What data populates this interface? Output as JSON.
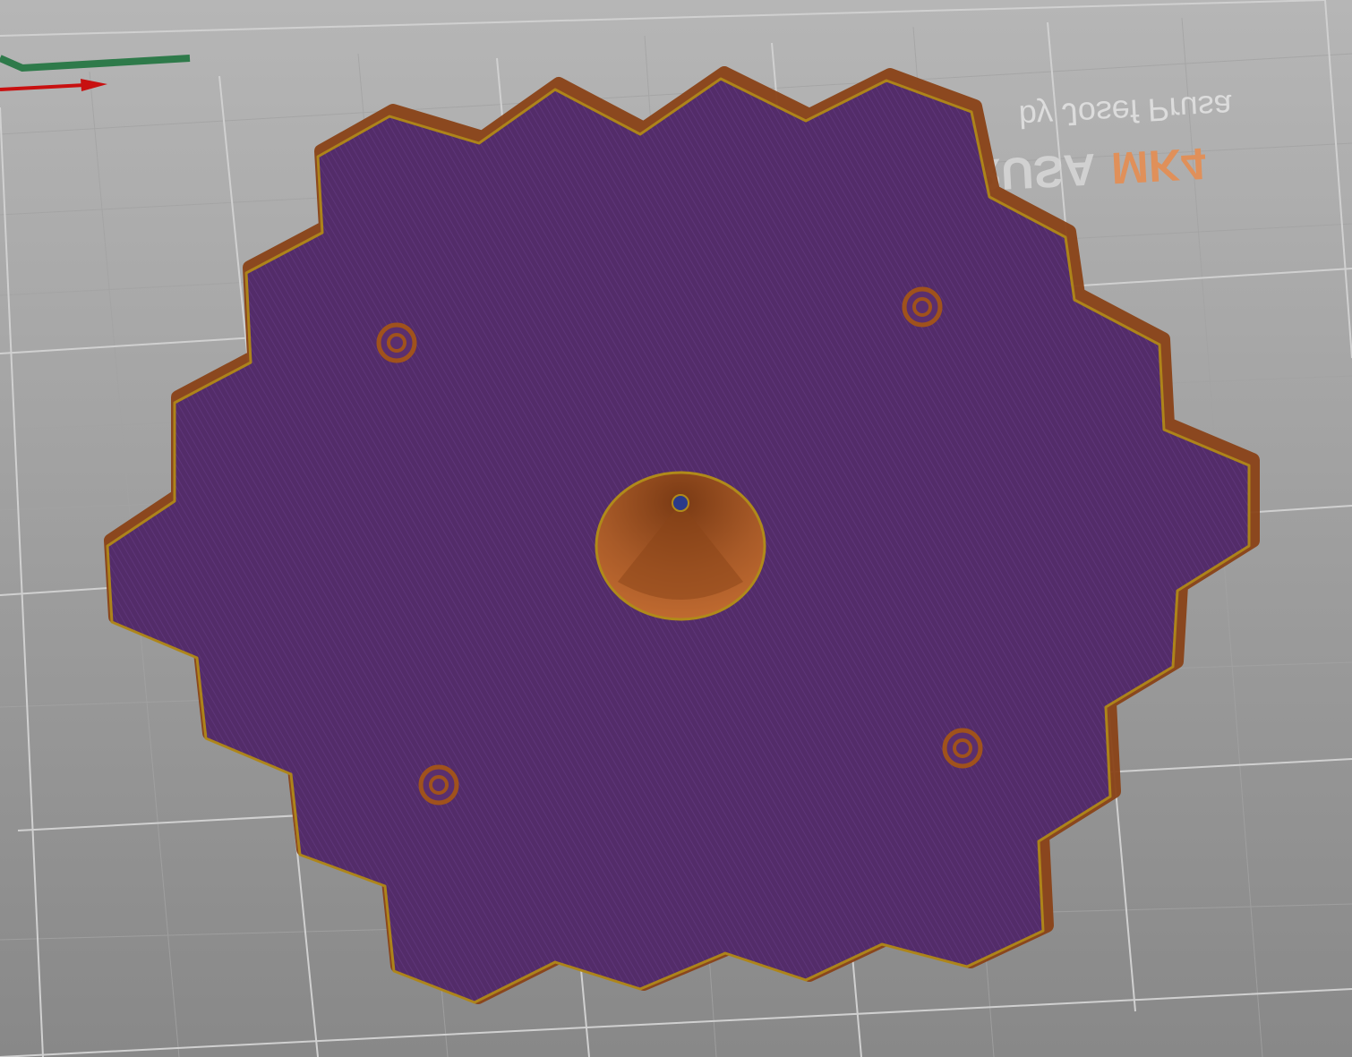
{
  "bed_logo": {
    "line1_a": "ORIGINAL PRUSA",
    "line1_b": "MK4",
    "line2": "by Josef Prusa"
  },
  "colors": {
    "bed_top": "#b4b4b4",
    "bed_bottom": "#8a8a8a",
    "object_fill": "#4e2a6e",
    "object_perimeter": "#8a4318",
    "perimeter_inner": "#b08a1a",
    "logo_accent": "#e0905a",
    "axis_x": "#c81010",
    "axis_y": "#2e7a4a"
  },
  "objects": {
    "holes": 4,
    "center_feature": "cone"
  }
}
